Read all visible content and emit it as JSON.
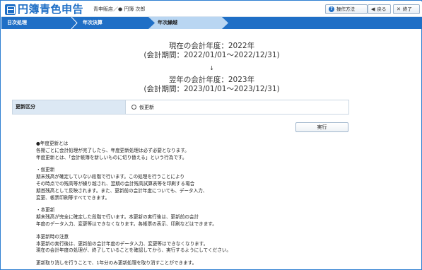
{
  "header": {
    "logo_text": "円簿青色申告",
    "user_info": "青申販店／● 円簿 次郎",
    "help_label": "操作方法",
    "help_icon": "?",
    "back_label": "戻る",
    "close_label": "終了"
  },
  "steps": [
    {
      "label": "日次処理"
    },
    {
      "label": "年次決算"
    },
    {
      "label": "年次繰越"
    }
  ],
  "current_year": {
    "line1": "現在の会計年度：2022年",
    "line2": "(会計期間：2022/01/01～2022/12/31)"
  },
  "arrow": "↓",
  "next_year": {
    "line1": "翌年の会計年度：2023年",
    "line2": "(会計期間：2023/01/01～2023/12/31)"
  },
  "form": {
    "label": "更新区分",
    "option_label": "仮更新"
  },
  "exec_label": "実行",
  "description": {
    "p1": [
      "●年度更新とは",
      "各期ごとに会計処理が完了したら、年度更新処理は必ず必要となります。",
      "年度更新とは、「会計帳簿を新しいものに切り替える」という行為です。"
    ],
    "p2": [
      "・仮更新",
      "期末残高が確定していない段階で行います。この処理を行うことにより",
      "その時点での残高等が繰り越され、翌期の会計残高試算表等を印刷する場合",
      "期首残高として反映されます。また、更新前の会計年度についても、データ入力、",
      "変更、帳票印刷等すべてできます。"
    ],
    "p3": [
      "・本更新",
      "期末残高が完全に確定した段階で行います。本更新の実行後は、更新前の会計",
      "年度のデータ入力、変更等はできなくなります。各帳票の表示、印刷などはできます。"
    ],
    "p4": [
      "本更新時の注意",
      "本更新の実行後は、更新前の会計年度のデータ入力、変更等はできなくなります。",
      "現在の会計年度の処理が、終了していることを確認してから、実行するようにしてください。"
    ],
    "p5": [
      "更新取り消しを行うことで、1年分のみ更新処理を取り消すことができます。"
    ]
  }
}
